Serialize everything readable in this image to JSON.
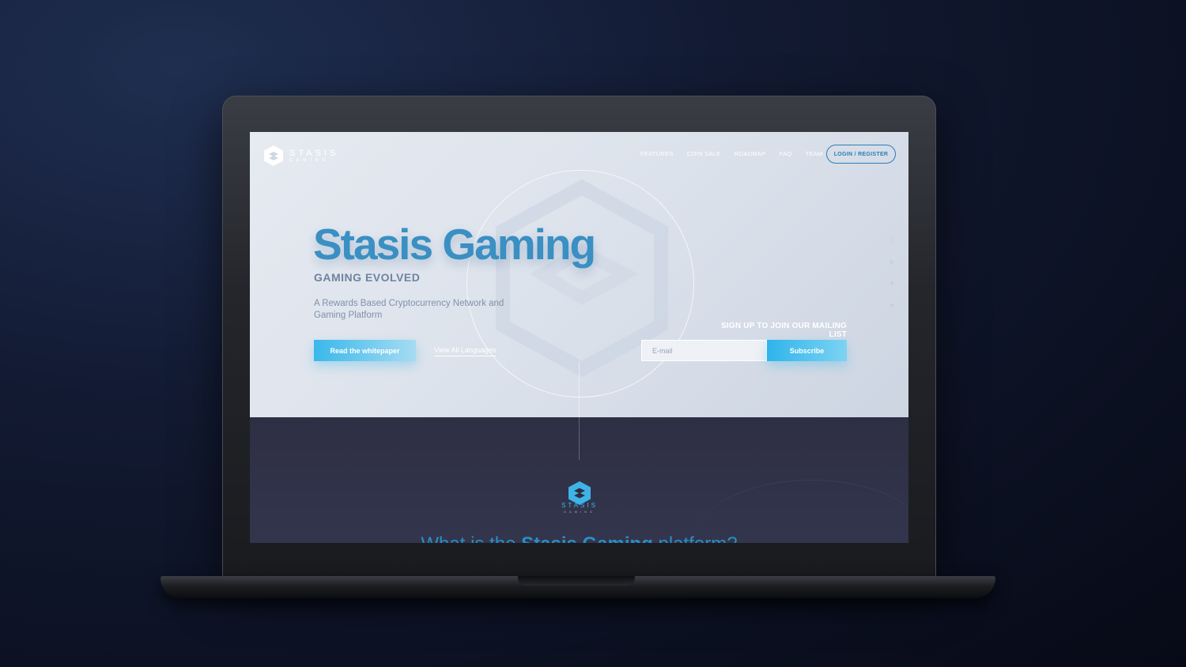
{
  "brand": {
    "name": "STASIS",
    "tagline": "GAMING"
  },
  "nav": {
    "items": [
      "FEATURES",
      "COIN SALE",
      "ROADMAP",
      "FAQ",
      "TEAM"
    ],
    "login": "LOGIN / REGISTER"
  },
  "hero": {
    "title": "Stasis Gaming",
    "subtitle": "GAMING EVOLVED",
    "description": "A Rewards Based Cryptocurrency Network and Gaming Platform",
    "whitepaper_button": "Read the whitepaper",
    "languages_link": "View All Languages"
  },
  "mailing": {
    "title": "SIGN UP TO JOIN OUR MAILING LIST",
    "email_placeholder": "E-mail",
    "subscribe_button": "Subscribe"
  },
  "social": [
    "facebook-icon",
    "telegram-icon",
    "twitter-icon",
    "reddit-icon"
  ],
  "section": {
    "title_pre": "What is the ",
    "title_bold": "Stasis Gaming",
    "title_post": " platform?"
  },
  "colors": {
    "accent": "#3a8fc3",
    "button": "#3ab8ea",
    "dark_bg": "#2e2f44"
  }
}
